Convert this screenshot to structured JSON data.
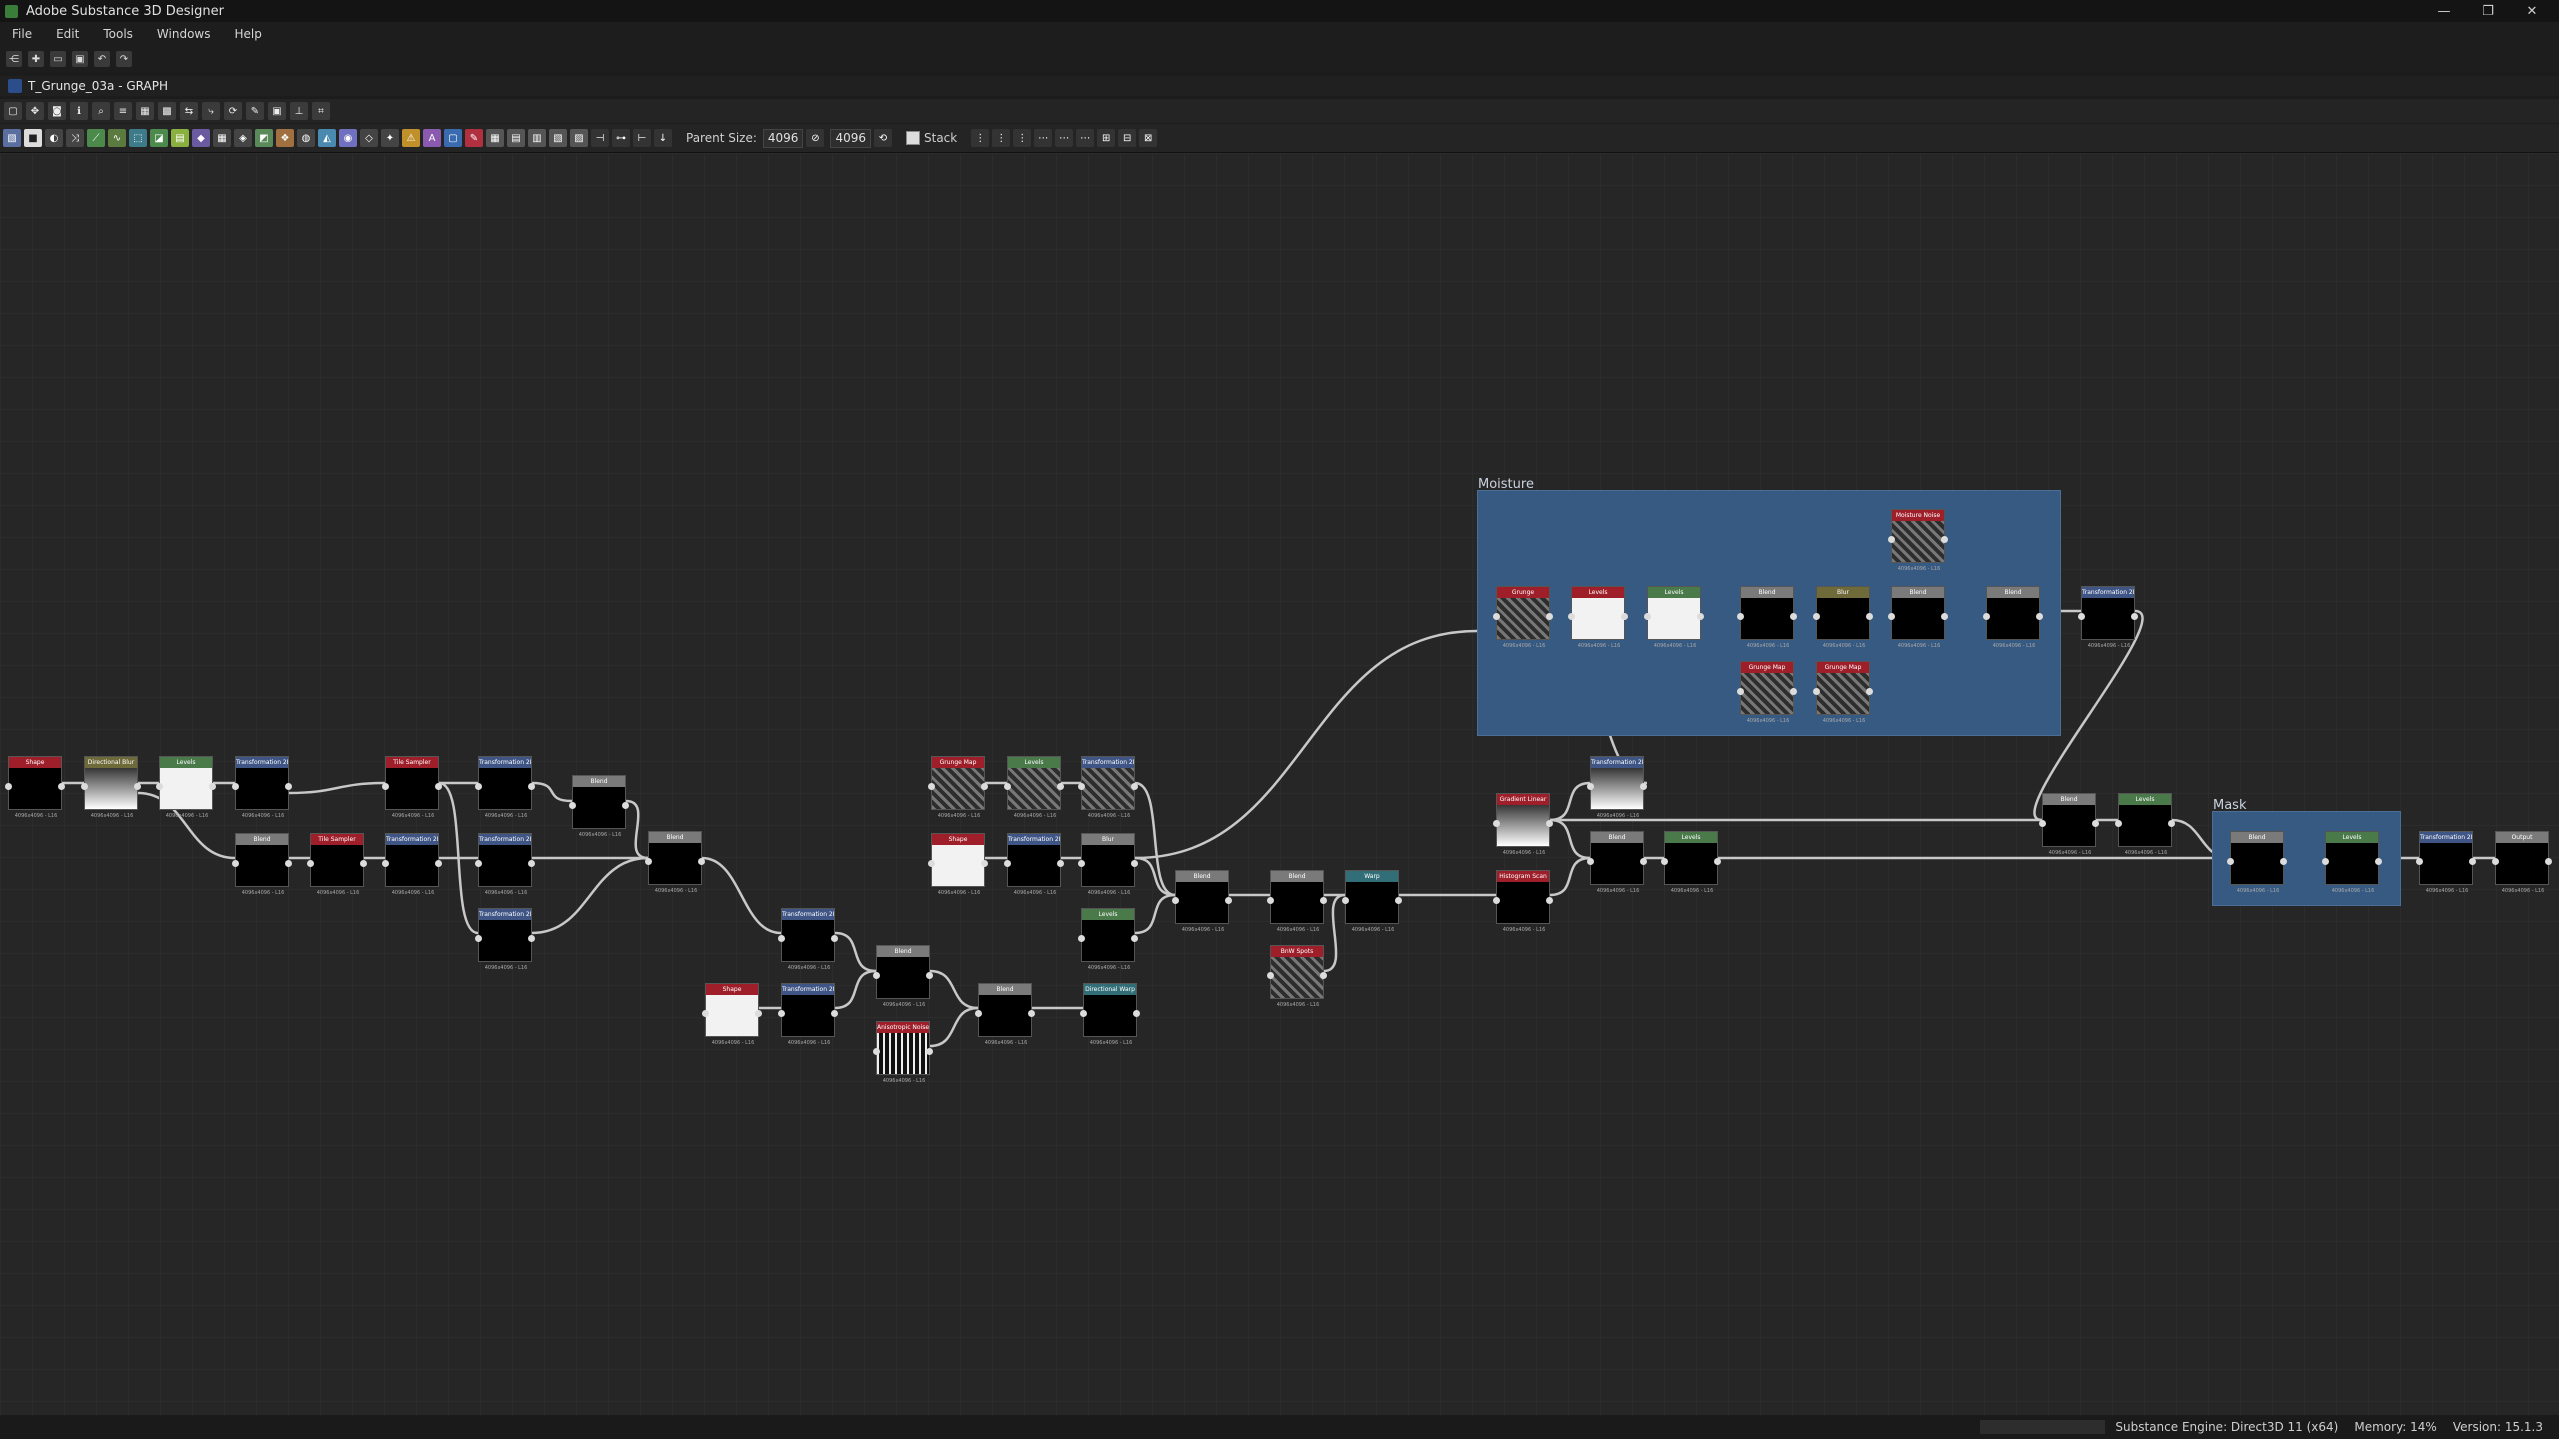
{
  "window": {
    "title": "Adobe Substance 3D Designer",
    "controls": [
      "—",
      "❐",
      "✕"
    ]
  },
  "menu": [
    "File",
    "Edit",
    "Tools",
    "Windows",
    "Help"
  ],
  "document": {
    "title": "T_Grunge_03a - GRAPH"
  },
  "graph_toolbar": {
    "parent_size_label": "Parent Size:",
    "parent_size_value": "4096",
    "size_value": "4096",
    "stack_label": "Stack"
  },
  "frames": [
    {
      "label": "Moisture"
    },
    {
      "label": "Mask"
    }
  ],
  "nodes": [
    {
      "title": "Shape",
      "footer": "4096x4096 - L16"
    },
    {
      "title": "Directional Blur",
      "footer": "4096x4096 - L16"
    },
    {
      "title": "Levels",
      "footer": "4096x4096 - L16"
    },
    {
      "title": "Transformation 2D",
      "footer": "4096x4096 - L16"
    },
    {
      "title": "Blend",
      "footer": "4096x4096 - L16"
    },
    {
      "title": "Tile Sampler",
      "footer": "4096x4096 - L16"
    },
    {
      "title": "Tile Sampler",
      "footer": "4096x4096 - L16"
    },
    {
      "title": "Transformation 2D",
      "footer": "4096x4096 - L16"
    },
    {
      "title": "Transformation 2D",
      "footer": "4096x4096 - L16"
    },
    {
      "title": "Transformation 2D",
      "footer": "4096x4096 - L16"
    },
    {
      "title": "Transformation 2D",
      "footer": "4096x4096 - L16"
    },
    {
      "title": "Blend",
      "footer": "4096x4096 - L16"
    },
    {
      "title": "Blend",
      "footer": "4096x4096 - L16"
    },
    {
      "title": "Transformation 2D",
      "footer": "4096x4096 - L16"
    },
    {
      "title": "Shape",
      "footer": "4096x4096 - L16"
    },
    {
      "title": "Transformation 2D",
      "footer": "4096x4096 - L16"
    },
    {
      "title": "Blend",
      "footer": "4096x4096 - L16"
    },
    {
      "title": "Anisotropic Noise",
      "footer": "4096x4096 - L16"
    },
    {
      "title": "Blend",
      "footer": "4096x4096 - L16"
    },
    {
      "title": "Directional Warp",
      "footer": "4096x4096 - L16"
    },
    {
      "title": "Grunge Map",
      "footer": "4096x4096 - L16"
    },
    {
      "title": "Levels",
      "footer": "4096x4096 - L16"
    },
    {
      "title": "Transformation 2D",
      "footer": "4096x4096 - L16"
    },
    {
      "title": "Shape",
      "footer": "4096x4096 - L16"
    },
    {
      "title": "Transformation 2D",
      "footer": "4096x4096 - L16"
    },
    {
      "title": "Blur",
      "footer": "4096x4096 - L16"
    },
    {
      "title": "Levels",
      "footer": "4096x4096 - L16"
    },
    {
      "title": "Blend",
      "footer": "4096x4096 - L16"
    },
    {
      "title": "Blend",
      "footer": "4096x4096 - L16"
    },
    {
      "title": "BnW Spots",
      "footer": "4096x4096 - L16"
    },
    {
      "title": "Warp",
      "footer": "4096x4096 - L16"
    },
    {
      "title": "Gradient Linear",
      "footer": "4096x4096 - L16"
    },
    {
      "title": "Transformation 2D",
      "footer": "4096x4096 - L16"
    },
    {
      "title": "Histogram Scan",
      "footer": "4096x4096 - L16"
    },
    {
      "title": "Blend",
      "footer": "4096x4096 - L16"
    },
    {
      "title": "Levels",
      "footer": "4096x4096 - L16"
    },
    {
      "title": "Grunge",
      "footer": "4096x4096 - L16"
    },
    {
      "title": "Levels",
      "footer": "4096x4096 - L16"
    },
    {
      "title": "Levels",
      "footer": "4096x4096 - L16"
    },
    {
      "title": "Blend",
      "footer": "4096x4096 - L16"
    },
    {
      "title": "Blur",
      "footer": "4096x4096 - L16"
    },
    {
      "title": "Blend",
      "footer": "4096x4096 - L16"
    },
    {
      "title": "Blend",
      "footer": "4096x4096 - L16"
    },
    {
      "title": "Transformation 2D",
      "footer": "4096x4096 - L16"
    },
    {
      "title": "Moisture Noise",
      "footer": "4096x4096 - L16"
    },
    {
      "title": "Grunge Map",
      "footer": "4096x4096 - L16"
    },
    {
      "title": "Grunge Map",
      "footer": "4096x4096 - L16"
    },
    {
      "title": "Blend",
      "footer": "4096x4096 - L16"
    },
    {
      "title": "Levels",
      "footer": "4096x4096 - L16"
    },
    {
      "title": "Blend",
      "footer": "4096x4096 - L16"
    },
    {
      "title": "Levels",
      "footer": "4096x4096 - L16"
    },
    {
      "title": "Transformation 2D",
      "footer": "4096x4096 - L16"
    },
    {
      "title": "Output",
      "footer": "4096x4096 - L16"
    }
  ],
  "status": {
    "engine": "Substance Engine: Direct3D 11 (x64)",
    "memory": "Memory: 14%",
    "version": "Version: 15.1.3"
  }
}
